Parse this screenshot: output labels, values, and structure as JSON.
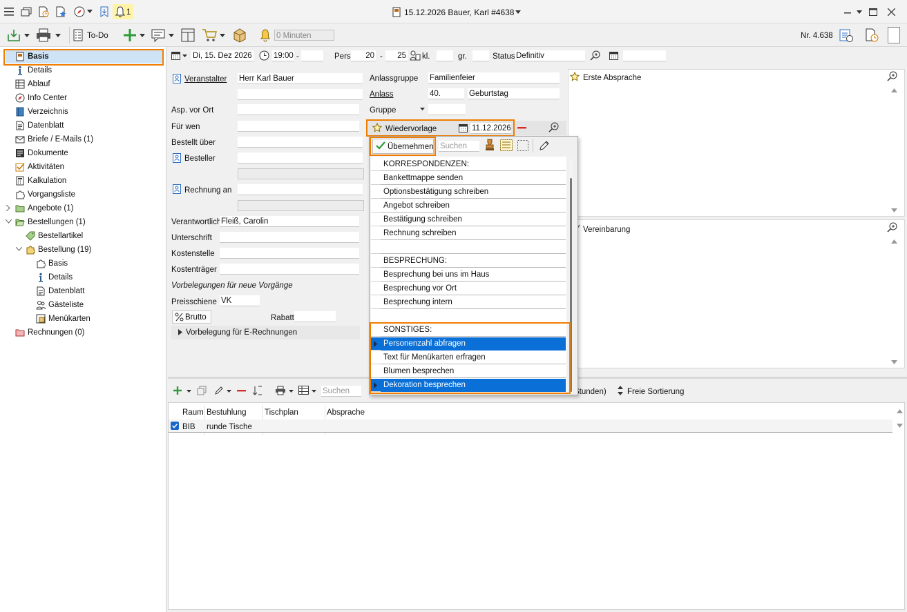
{
  "window": {
    "title": "15.12.2026 Bauer, Karl #4638",
    "notif_count": "1"
  },
  "toolbar": {
    "todo_label": "To-Do",
    "minutes_placeholder": "0 Minuten",
    "number": "Nr. 4.638"
  },
  "sidebar": {
    "items": [
      {
        "label": "Basis",
        "icon": "basis-icon"
      },
      {
        "label": "Details",
        "icon": "info-icon"
      },
      {
        "label": "Ablauf",
        "icon": "table-icon"
      },
      {
        "label": "Info Center",
        "icon": "compass-icon"
      },
      {
        "label": "Verzeichnis",
        "icon": "book-icon"
      },
      {
        "label": "Datenblatt",
        "icon": "sheet-icon"
      },
      {
        "label": "Briefe / E-Mails (1)",
        "icon": "letter-icon"
      },
      {
        "label": "Dokumente",
        "icon": "document-icon"
      },
      {
        "label": "Aktivitäten",
        "icon": "checkbox-icon"
      },
      {
        "label": "Kalkulation",
        "icon": "calculator-icon"
      },
      {
        "label": "Vorgangsliste",
        "icon": "puzzle-icon"
      },
      {
        "label": "Angebote (1)",
        "icon": "folder-icon"
      },
      {
        "label": "Bestellungen (1)",
        "icon": "folder-open-icon"
      },
      {
        "label": "Bestellartikel",
        "icon": "tag-icon"
      },
      {
        "label": "Bestellung (19)",
        "icon": "puzzle-icon"
      },
      {
        "label": "Basis",
        "icon": "puzzle-icon"
      },
      {
        "label": "Details",
        "icon": "info-icon"
      },
      {
        "label": "Datenblatt",
        "icon": "sheet-icon"
      },
      {
        "label": "Gästeliste",
        "icon": "people-icon"
      },
      {
        "label": "Menükarten",
        "icon": "menu-card-icon"
      },
      {
        "label": "Rechnungen (0)",
        "icon": "folder-icon"
      }
    ]
  },
  "datebar": {
    "date": "Di, 15. Dez 2026",
    "time_from": "19:00",
    "time_sep": "-",
    "pers_label": "Pers.",
    "pers_from": "20",
    "pers_sep": "-",
    "pers_to": "25",
    "kl_label": "kl.",
    "gr_label": "gr.",
    "status_label": "Status",
    "status_value": "Definitiv"
  },
  "form": {
    "veranstalter_label": "Veranstalter",
    "veranstalter_value": "Herr Karl Bauer",
    "asp_label": "Asp. vor Ort",
    "fuer_wen_label": "Für wen",
    "bestellt_label": "Bestellt über",
    "besteller_label": "Besteller",
    "rechnung_label": "Rechnung an",
    "verantwortlich_label": "Verantwortlich",
    "verantwortlich_value": "Fleiß, Carolin",
    "unterschrift_label": "Unterschrift",
    "kostenstelle_label": "Kostenstelle",
    "kostentraeger_label": "Kostenträger",
    "vorbelegungen_label": "Vorbelegungen für neue Vorgänge",
    "preisschiene_label": "Preisschiene",
    "preisschiene_value": "VK",
    "brutto_label": "Brutto",
    "rabatt_label": "Rabatt",
    "erechnung_label": "Vorbelegung für E-Rechnungen",
    "anlassgruppe_label": "Anlassgruppe",
    "anlassgruppe_value": "Familienfeier",
    "anlass_label": "Anlass",
    "anlass_num": "40.",
    "anlass_value": "Geburtstag",
    "gruppe_label": "Gruppe",
    "wiedervorlage_label": "Wiedervorlage",
    "wiedervorlage_date": "11.12.2026"
  },
  "right": {
    "erste_absprache": "Erste Absprache",
    "vereinbarung": "Vereinbarung"
  },
  "dropdown": {
    "uebernehmen_label": "Übernehmen",
    "search_placeholder": "Suchen",
    "rows": [
      {
        "text": "KORRESPONDENZEN:",
        "sel": false
      },
      {
        "text": "Bankettmappe senden",
        "sel": false
      },
      {
        "text": "Optionsbestätigung schreiben",
        "sel": false
      },
      {
        "text": "Angebot schreiben",
        "sel": false
      },
      {
        "text": "Bestätigung schreiben",
        "sel": false
      },
      {
        "text": "Rechnung schreiben",
        "sel": false
      },
      {
        "text": "",
        "sel": false
      },
      {
        "text": "BESPRECHUNG:",
        "sel": false
      },
      {
        "text": "Besprechung bei uns im Haus",
        "sel": false
      },
      {
        "text": "Besprechung vor Ort",
        "sel": false
      },
      {
        "text": "Besprechung intern",
        "sel": false
      },
      {
        "text": "",
        "sel": false
      },
      {
        "text": "SONSTIGES:",
        "sel": false
      },
      {
        "text": "Personenzahl abfragen",
        "sel": true
      },
      {
        "text": "Text für Menükarten erfragen",
        "sel": false
      },
      {
        "text": "Blumen besprechen",
        "sel": false
      },
      {
        "text": "Dekoration besprechen",
        "sel": true
      }
    ]
  },
  "bottom": {
    "search_placeholder": "Suchen",
    "stunden_label": "Stunden)",
    "sort_label": "Freie Sortierung",
    "columns": [
      "Raum",
      "Bestuhlung",
      "Tischplan",
      "Absprache"
    ],
    "rows": [
      {
        "raum": "BIB",
        "bestuhlung": "runde Tische",
        "tischplan": "",
        "absprache": ""
      }
    ]
  }
}
